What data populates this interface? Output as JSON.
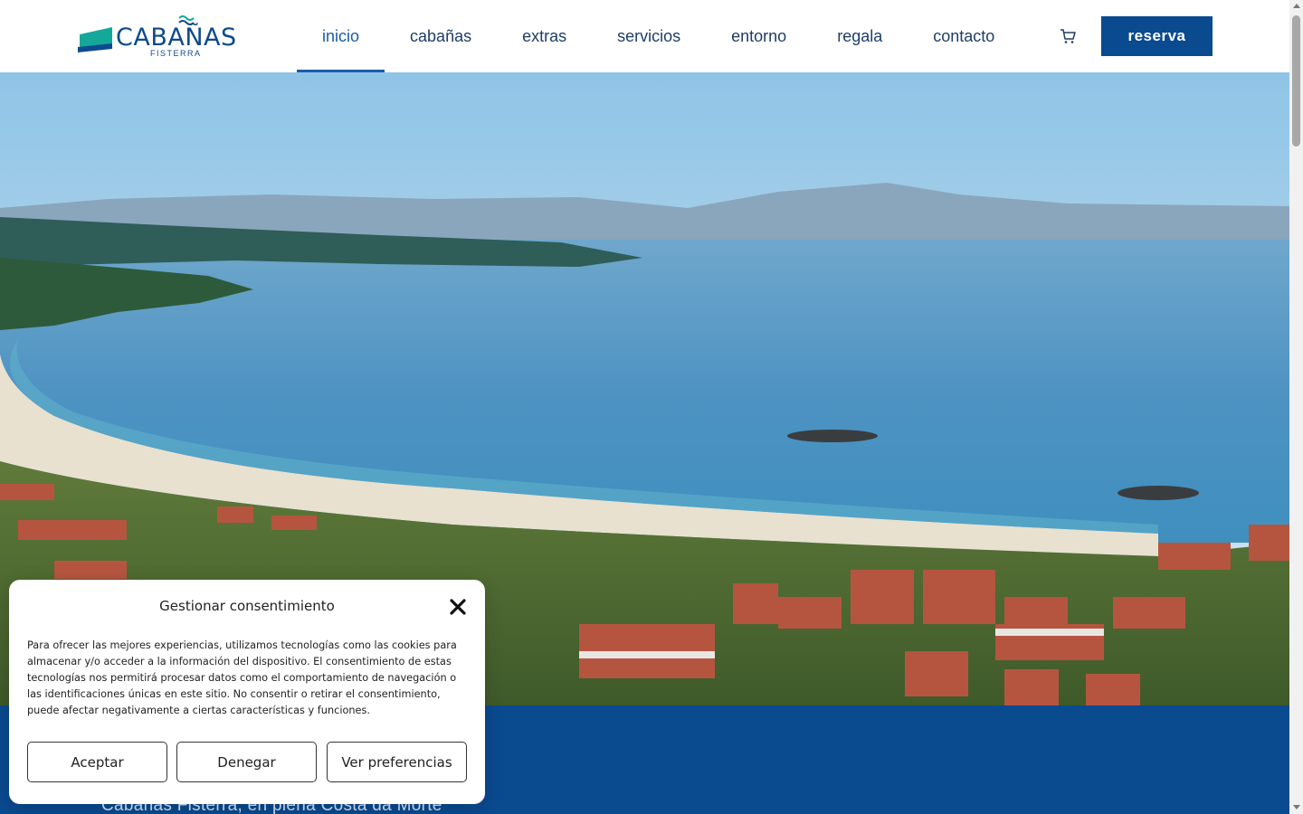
{
  "header": {
    "logo": {
      "name": "CABAÑAS",
      "sub": "FISTERRA"
    },
    "nav": [
      {
        "label": "inicio",
        "active": true
      },
      {
        "label": "cabañas",
        "active": false
      },
      {
        "label": "extras",
        "active": false
      },
      {
        "label": "servicios",
        "active": false
      },
      {
        "label": "entorno",
        "active": false
      },
      {
        "label": "regala",
        "active": false
      },
      {
        "label": "contacto",
        "active": false
      }
    ],
    "cart_icon": "shopping-cart-icon",
    "cta_label": "reserva"
  },
  "hero": {
    "image": "aerial-coastline-beach-town"
  },
  "band": {
    "text": "Cabañas Fisterra, en plena Costa da Morte"
  },
  "consent": {
    "title": "Gestionar consentimiento",
    "close_icon": "close-icon",
    "body": "Para ofrecer las mejores experiencias, utilizamos tecnologías como las cookies para almacenar y/o acceder a la información del dispositivo. El consentimiento de estas tecnologías nos permitirá procesar datos como el comportamiento de navegación o las identificaciones únicas en este sitio. No consentir o retirar el consentimiento, puede afectar negativamente a ciertas características y funciones.",
    "accept_label": "Aceptar",
    "deny_label": "Denegar",
    "prefs_label": "Ver preferencias"
  },
  "colors": {
    "brand_blue": "#0a4a8f",
    "nav_text": "#1f3d68",
    "active_nav": "#1a5da8",
    "logo_teal": "#14a89a"
  }
}
